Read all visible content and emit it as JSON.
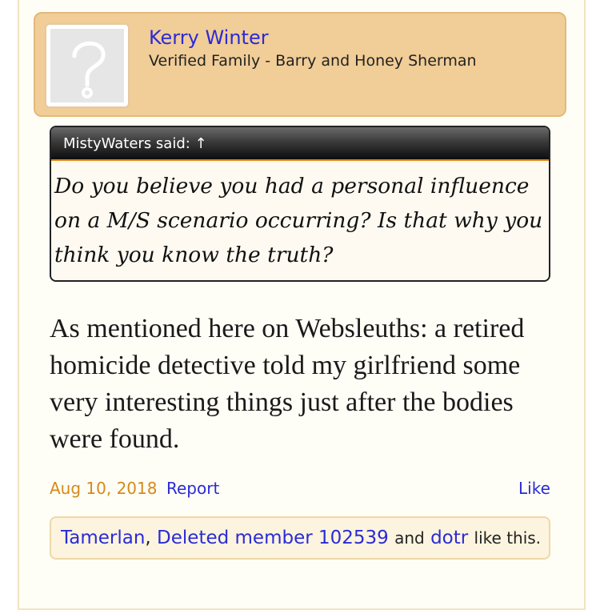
{
  "user": {
    "name": "Kerry Winter",
    "title": "Verified Family - Barry and Honey Sherman",
    "avatar_icon": "unknown-avatar-question-mark"
  },
  "quote": {
    "attribution": "MistyWaters said: ↑",
    "text": "Do you believe you had a personal influence on a M/S scenario occurring? Is that why you think you know the truth?"
  },
  "message": {
    "text": "As mentioned here on Websleuths: a retired homicide detective told my girlfriend some very interesting things just after the bodies were found."
  },
  "footer": {
    "date": "Aug 10, 2018",
    "report_label": "Report",
    "like_label": "Like"
  },
  "likes": {
    "users": [
      "Tamerlan",
      "Deleted member 102539",
      "dotr"
    ],
    "separator": ", ",
    "and_word": "and",
    "suffix": "like this."
  },
  "colors": {
    "link": "#2b2bd6",
    "date": "#d68a18",
    "userbar_bg": "#f1cd97",
    "quote_accent": "#e0891c"
  }
}
